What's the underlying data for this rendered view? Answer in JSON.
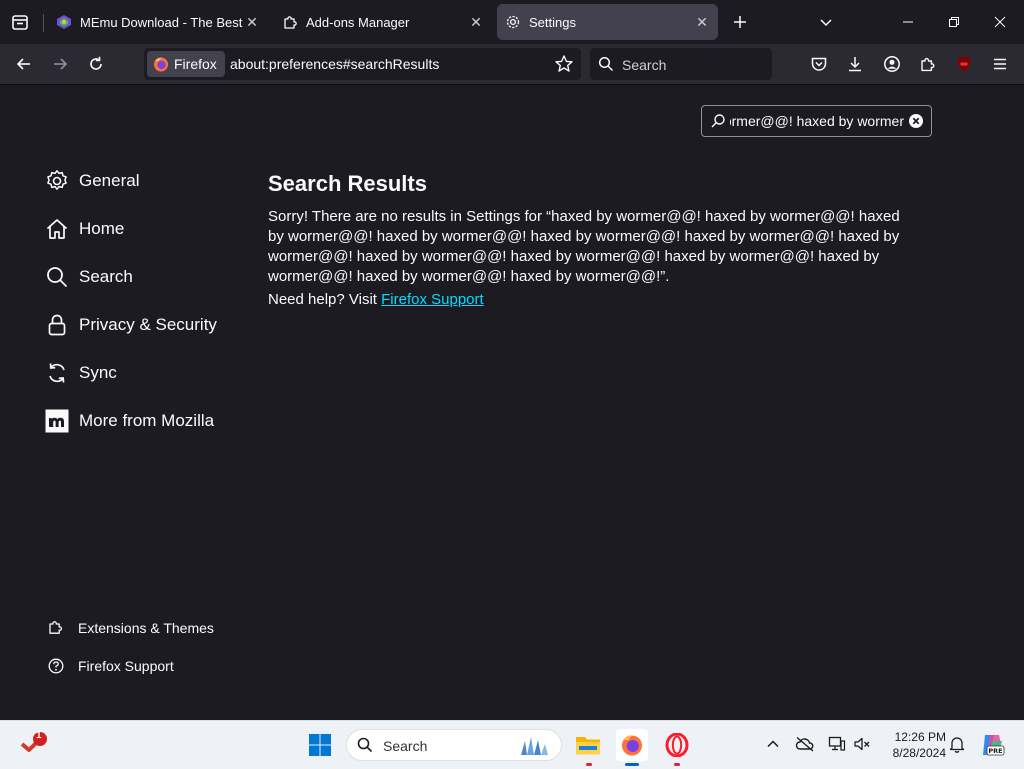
{
  "tabs": [
    {
      "title": "MEmu Download - The Best Android Emulator",
      "active": false
    },
    {
      "title": "Add-ons Manager",
      "active": false
    },
    {
      "title": "Settings",
      "active": true
    }
  ],
  "navbar": {
    "identity_label": "Firefox",
    "url": "about:preferences#searchResults",
    "search_placeholder": "Search"
  },
  "prefs_search": {
    "value": "haxed by wormer@@! haxed by wormer@@! haxed by wormer@@! haxed by wormer@@! haxed by wormer@@! haxed by wormer@@! haxed by wormer@@! haxed by wormer@@! haxed by wormer@@! haxed by wormer@@! haxed by wormer@@! haxed by wormer@@! haxed by wormer@@!"
  },
  "sidebar": {
    "categories": [
      {
        "label": "General",
        "icon": "gear-icon"
      },
      {
        "label": "Home",
        "icon": "home-icon"
      },
      {
        "label": "Search",
        "icon": "search-icon"
      },
      {
        "label": "Privacy & Security",
        "icon": "lock-icon"
      },
      {
        "label": "Sync",
        "icon": "sync-icon"
      },
      {
        "label": "More from Mozilla",
        "icon": "mozilla-icon"
      }
    ],
    "footer": [
      {
        "label": "Extensions & Themes",
        "icon": "puzzle-icon"
      },
      {
        "label": "Firefox Support",
        "icon": "help-icon"
      }
    ]
  },
  "main": {
    "title": "Search Results",
    "message": "Sorry! There are no results in Settings for “haxed by wormer@@! haxed by wormer@@! haxed by wormer@@! haxed by wormer@@! haxed by wormer@@! haxed by wormer@@! haxed by wormer@@! haxed by wormer@@! haxed by wormer@@! haxed by wormer@@! haxed by wormer@@! haxed by wormer@@! haxed by wormer@@!”.",
    "help_prefix": "Need help? Visit ",
    "help_link": "Firefox Support"
  },
  "taskbar": {
    "search_label": "Search",
    "notification_badge": "1",
    "time": "12:26 PM",
    "date": "8/28/2024"
  },
  "colors": {
    "background": "#1c1b22",
    "toolbar": "#2b2a33",
    "active_tab": "#42414d",
    "link": "#00ddff",
    "text": "#fbfbfe"
  }
}
